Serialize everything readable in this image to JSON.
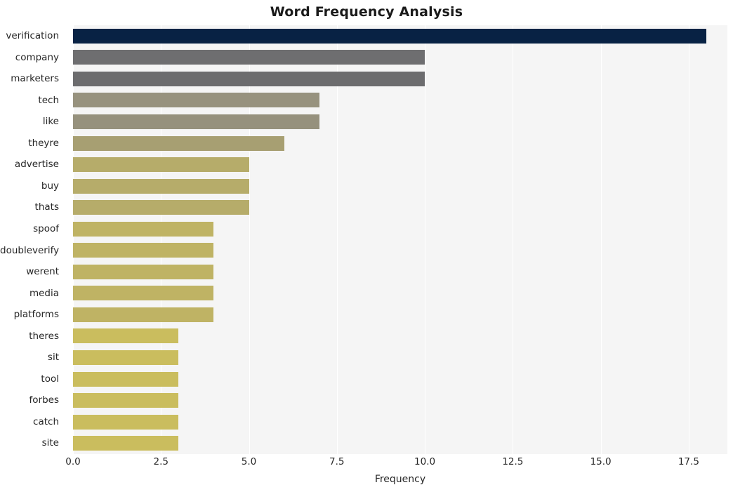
{
  "chart_data": {
    "type": "bar",
    "orientation": "horizontal",
    "title": "Word Frequency Analysis",
    "xlabel": "Frequency",
    "ylabel": "",
    "xlim": [
      0,
      18.6
    ],
    "grid": true,
    "legend": null,
    "xticks": [
      "0.0",
      "2.5",
      "5.0",
      "7.5",
      "10.0",
      "12.5",
      "15.0",
      "17.5"
    ],
    "xtick_values": [
      0,
      2.5,
      5,
      7.5,
      10,
      12.5,
      15,
      17.5
    ],
    "categories": [
      "verification",
      "company",
      "marketers",
      "tech",
      "like",
      "theyre",
      "advertise",
      "buy",
      "thats",
      "spoof",
      "doubleverify",
      "werent",
      "media",
      "platforms",
      "theres",
      "sit",
      "tool",
      "forbes",
      "catch",
      "site"
    ],
    "values": [
      18,
      10,
      10,
      7,
      7,
      6,
      5,
      5,
      5,
      4,
      4,
      4,
      4,
      4,
      3,
      3,
      3,
      3,
      3,
      3
    ],
    "bar_colors": [
      "#082244",
      "#6e6e70",
      "#6c6c6e",
      "#97927e",
      "#96917d",
      "#a79f72",
      "#b6ac6a",
      "#b6ac6a",
      "#b6ac6a",
      "#bfb364",
      "#bfb364",
      "#bfb364",
      "#bfb364",
      "#bfb364",
      "#cabd5e",
      "#cabd5e",
      "#cabd5e",
      "#cabd5e",
      "#cabd5e",
      "#cabd5e"
    ],
    "plot_background": "#f5f5f5",
    "grid_color": "#ffffff"
  }
}
